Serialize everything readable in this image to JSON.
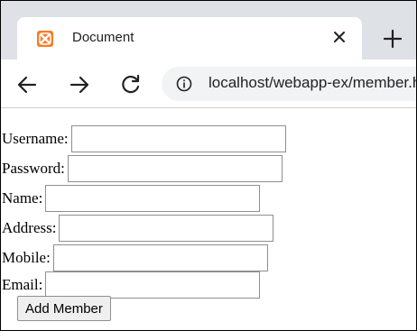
{
  "browser": {
    "tab_title": "Document",
    "tab_close_icon": "close-icon",
    "new_tab_icon": "plus-icon",
    "url": "localhost/webapp-ex/member.html",
    "colors": {
      "tabstrip": "#dee1e6",
      "favicon": "#fb7a24",
      "omnibox": "#f1f3f4"
    }
  },
  "form": {
    "fields": [
      {
        "label": "Username:",
        "value": ""
      },
      {
        "label": "Password:",
        "value": ""
      },
      {
        "label": "Name:",
        "value": ""
      },
      {
        "label": "Address:",
        "value": ""
      },
      {
        "label": "Mobile:",
        "value": ""
      },
      {
        "label": "Email:",
        "value": ""
      }
    ],
    "submit_label": "Add Member"
  }
}
